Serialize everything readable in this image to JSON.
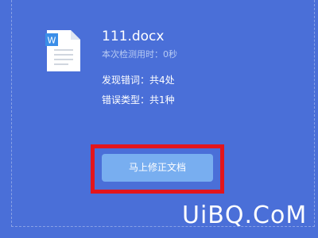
{
  "file": {
    "name": "111.docx",
    "icon": "word-document-icon",
    "icon_badge": "W"
  },
  "result": {
    "duration_label": "本次检测用时：0秒",
    "errors_found": "发现错词：共4处",
    "error_types": "错误类型：共1种"
  },
  "actions": {
    "fix_label": "马上修正文档"
  },
  "watermark": "UiBQ.CoM",
  "colors": {
    "background": "#4a6fd8",
    "button": "#78aef0",
    "highlight": "#e3151c",
    "badge": "#3b8ee8"
  }
}
